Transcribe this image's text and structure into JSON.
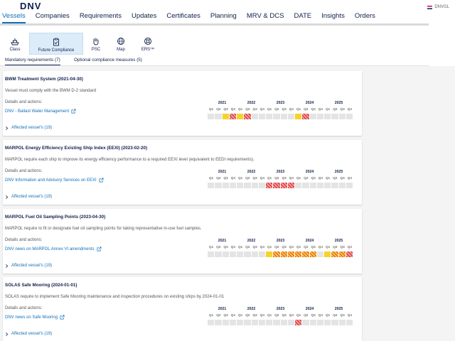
{
  "app": {
    "logo": "DNV",
    "user": "DNVGL"
  },
  "nav": {
    "items": [
      {
        "label": "Vessels",
        "active": true
      },
      {
        "label": "Companies"
      },
      {
        "label": "Requirements"
      },
      {
        "label": "Updates"
      },
      {
        "label": "Certificates"
      },
      {
        "label": "Planning"
      },
      {
        "label": "MRV & DCS"
      },
      {
        "label": "DATE"
      },
      {
        "label": "Insights"
      },
      {
        "label": "Orders"
      }
    ]
  },
  "subnav": {
    "items": [
      {
        "label": "Class",
        "icon": "ship-icon"
      },
      {
        "label": "Future Compliance",
        "icon": "clipboard-check-icon",
        "active": true
      },
      {
        "label": "PSC",
        "icon": "hand-icon"
      },
      {
        "label": "Map",
        "icon": "globe-icon"
      },
      {
        "label": "ERS™",
        "icon": "lifebuoy-icon"
      }
    ]
  },
  "tabs": [
    {
      "label": "Mandatory requirements (7)",
      "active": true
    },
    {
      "label": "Optional compliance measures (5)"
    }
  ],
  "timeline": {
    "years": [
      "2021",
      "2022",
      "2023",
      "2024",
      "2025"
    ],
    "quarters": [
      "Q1",
      "Q2",
      "Q3",
      "Q4"
    ]
  },
  "colors": {
    "yellow": "#f6d22d",
    "red_hatched": "#d93d3d",
    "orange_hatched": "#e86a28",
    "empty": "#e4e4e4"
  },
  "requirements": [
    {
      "title": "BWM Treatment System (2021-04-30)",
      "description": "Vessel must comply with the BWM D-2 standard",
      "details_label": "Details and actions:",
      "link": "DNV - Ballast Water Management",
      "affected": "Affected vessel's (19)",
      "cells": [
        "",
        "",
        "y",
        "r",
        "y",
        "r",
        "",
        "",
        "",
        "",
        "",
        "",
        "y",
        "r",
        "",
        "",
        "",
        "",
        "",
        ""
      ]
    },
    {
      "title": "MARPOL Energy Efficiency Existing Ship Index (EEXI) (2023-02-20)",
      "description": "MARPOL require each ship to improve its energy efficiency performance to a required EEXI level (equivalent to EEDI requirements).",
      "details_label": "Details and actions:",
      "link": "DNV Information and Advisory Services on EEXI",
      "affected": "Affected vessel's (19)",
      "cells": [
        "",
        "",
        "",
        "",
        "",
        "",
        "",
        "",
        "r",
        "r",
        "r",
        "r",
        "",
        "",
        "",
        "",
        "",
        "",
        "",
        ""
      ]
    },
    {
      "title": "MARPOL Fuel Oil Sampling Points (2023-04-30)",
      "description": "MARPOL require to fit or designate fuel oil sampling points for taking representative in-use fuel samples.",
      "details_label": "Details and actions:",
      "link": "DNV news on MARPOL Annex VI amendments",
      "affected": "Affected vessel's (19)",
      "cells": [
        "",
        "",
        "",
        "",
        "",
        "",
        "",
        "",
        "y",
        "o",
        "o",
        "o",
        "o",
        "o",
        "o",
        "",
        "y",
        "o",
        "o",
        "r"
      ]
    },
    {
      "title": "SOLAS Safe Mooring (2024-01-01)",
      "description": "SOLAS require to implement Safe Mooring maintenance and inspection procedures on existing ships by 2024-01-01",
      "details_label": "Details and actions:",
      "link": "DNV news on Safe Mooring",
      "affected": "Affected vessel's (19)",
      "cells": [
        "",
        "",
        "",
        "",
        "",
        "",
        "",
        "",
        "",
        "",
        "",
        "",
        "r",
        "",
        "",
        "",
        "",
        "",
        "",
        ""
      ]
    }
  ]
}
